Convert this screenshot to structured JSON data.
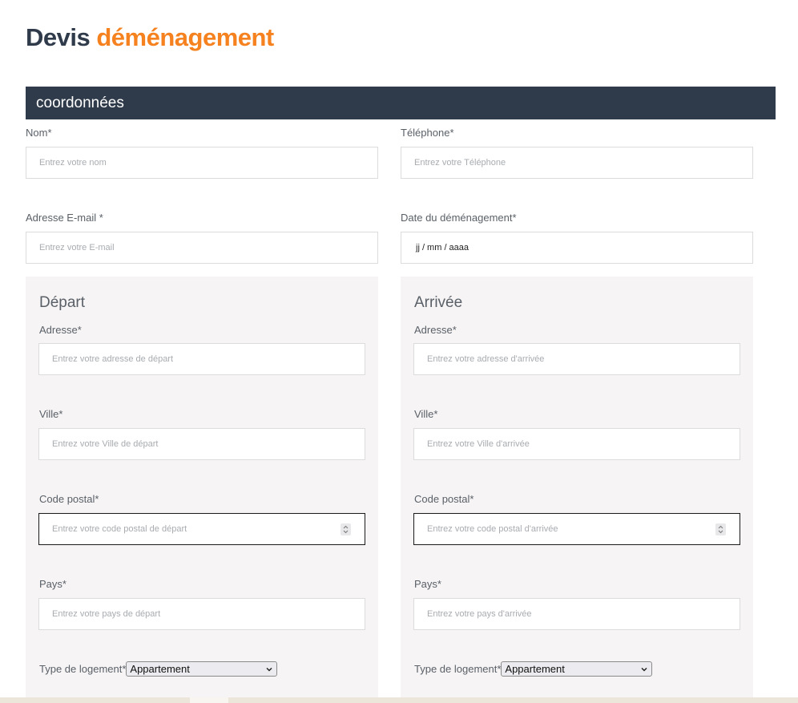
{
  "title": {
    "part1": "Devis",
    "part2": "déménagement"
  },
  "section": {
    "title": "coordonnées"
  },
  "contact": {
    "nom": {
      "label": "Nom*",
      "placeholder": "Entrez votre nom"
    },
    "telephone": {
      "label": "Téléphone*",
      "placeholder": "Entrez votre Téléphone"
    },
    "email": {
      "label": "Adresse E-mail *",
      "placeholder": "Entrez votre E-mail"
    },
    "date": {
      "label": "Date du déménagement*",
      "value": "jj / mm / aaaa"
    }
  },
  "depart": {
    "title": "Départ",
    "adresse": {
      "label": "Adresse*",
      "placeholder": "Entrez votre adresse de départ"
    },
    "ville": {
      "label": "Ville*",
      "placeholder": "Entrez votre Ville de départ"
    },
    "code_postal": {
      "label": "Code postal*",
      "placeholder": "Entrez votre code postal de départ"
    },
    "pays": {
      "label": "Pays*",
      "placeholder": "Entrez votre pays de départ"
    },
    "logement": {
      "label": "Type de logement*",
      "value": "Appartement"
    }
  },
  "arrivee": {
    "title": "Arrivée",
    "adresse": {
      "label": "Adresse*",
      "placeholder": "Entrez votre adresse d'arrivée"
    },
    "ville": {
      "label": "Ville*",
      "placeholder": "Entrez votre Ville d'arrivée"
    },
    "code_postal": {
      "label": "Code postal*",
      "placeholder": "Entrez votre code postal d'arrivée"
    },
    "pays": {
      "label": "Pays*",
      "placeholder": "Entrez votre pays d'arrivée"
    },
    "logement": {
      "label": "Type de logement*",
      "value": "Appartement"
    }
  },
  "colors": {
    "navy": "#2f3b4a",
    "orange": "#f5821f",
    "panel": "#f6f4f4"
  }
}
